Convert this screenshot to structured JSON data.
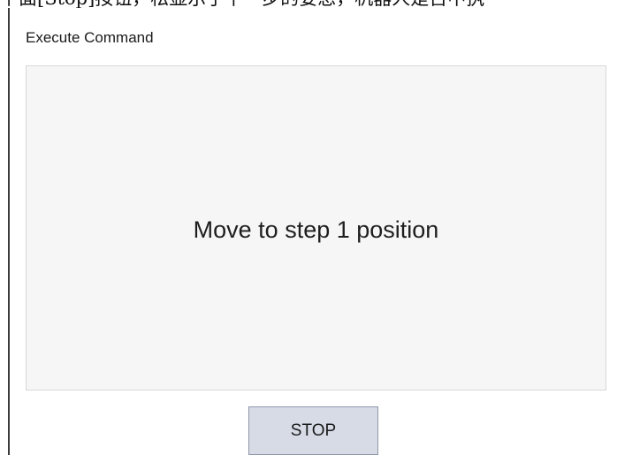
{
  "dialog": {
    "title": "Execute Command",
    "message": "Move to step 1 position",
    "stop_label": "STOP"
  },
  "background": {
    "top_text": "下面[Stop]按钮，松显示了下一步的要息，机器人是否中执"
  }
}
